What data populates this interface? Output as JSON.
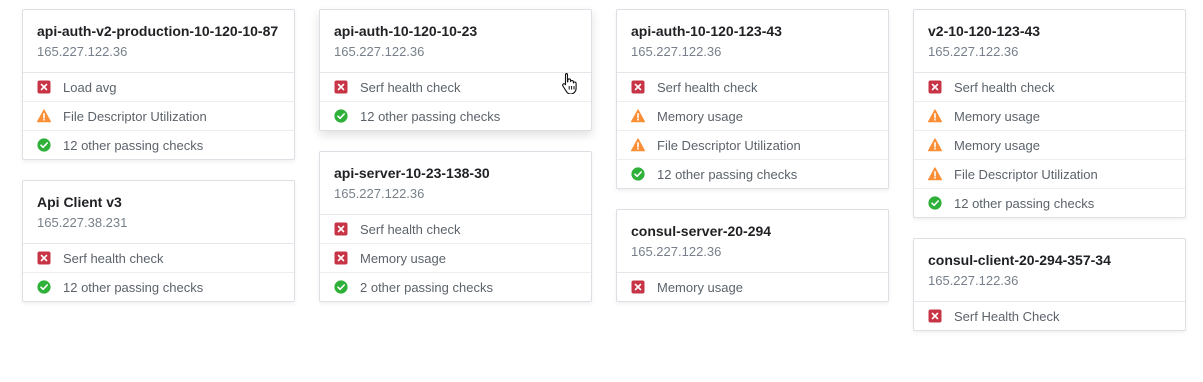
{
  "colors": {
    "critical": "#c73445",
    "warning": "#fa8f37",
    "passing": "#2eb039",
    "border": "#dcdfe3",
    "muted": "#77808a"
  },
  "nodes": [
    [
      {
        "name": "api-auth-v2-production-10-120-10-87",
        "address": "165.227.122.36",
        "checks": [
          {
            "status": "critical",
            "icon": "critical-icon",
            "label": "Load avg"
          },
          {
            "status": "warning",
            "icon": "warning-icon",
            "label": "File Descriptor Utilization"
          },
          {
            "status": "passing",
            "icon": "passing-icon",
            "label": "12 other passing checks"
          }
        ]
      },
      {
        "name": "Api Client v3",
        "address": "165.227.38.231",
        "checks": [
          {
            "status": "critical",
            "icon": "critical-icon",
            "label": "Serf health check"
          },
          {
            "status": "passing",
            "icon": "passing-icon",
            "label": "12 other passing checks"
          }
        ]
      }
    ],
    [
      {
        "name": "api-auth-10-120-10-23",
        "address": "165.227.122.36",
        "hovered": true,
        "checks": [
          {
            "status": "critical",
            "icon": "critical-icon",
            "label": "Serf health check"
          },
          {
            "status": "passing",
            "icon": "passing-icon",
            "label": "12 other passing checks"
          }
        ]
      },
      {
        "name": "api-server-10-23-138-30",
        "address": "165.227.122.36",
        "checks": [
          {
            "status": "critical",
            "icon": "critical-icon",
            "label": "Serf health check"
          },
          {
            "status": "critical",
            "icon": "critical-icon",
            "label": "Memory usage"
          },
          {
            "status": "passing",
            "icon": "passing-icon",
            "label": "2 other passing checks"
          }
        ]
      }
    ],
    [
      {
        "name": "api-auth-10-120-123-43",
        "address": "165.227.122.36",
        "checks": [
          {
            "status": "critical",
            "icon": "critical-icon",
            "label": "Serf health check"
          },
          {
            "status": "warning",
            "icon": "warning-icon",
            "label": "Memory usage"
          },
          {
            "status": "warning",
            "icon": "warning-icon",
            "label": "File Descriptor Utilization"
          },
          {
            "status": "passing",
            "icon": "passing-icon",
            "label": "12 other passing checks"
          }
        ]
      },
      {
        "name": "consul-server-20-294",
        "address": "165.227.122.36",
        "checks": [
          {
            "status": "critical",
            "icon": "critical-icon",
            "label": "Memory usage"
          }
        ]
      }
    ],
    [
      {
        "name": "v2-10-120-123-43",
        "address": "165.227.122.36",
        "checks": [
          {
            "status": "critical",
            "icon": "critical-icon",
            "label": "Serf health check"
          },
          {
            "status": "warning",
            "icon": "warning-icon",
            "label": "Memory usage"
          },
          {
            "status": "warning",
            "icon": "warning-icon",
            "label": "Memory usage"
          },
          {
            "status": "warning",
            "icon": "warning-icon",
            "label": "File Descriptor Utilization"
          },
          {
            "status": "passing",
            "icon": "passing-icon",
            "label": "12 other passing checks"
          }
        ]
      },
      {
        "name": "consul-client-20-294-357-34",
        "address": "165.227.122.36",
        "checks": [
          {
            "status": "critical",
            "icon": "critical-icon",
            "label": "Serf Health Check"
          }
        ]
      }
    ]
  ],
  "cursor": {
    "icon": "hand-pointer-icon"
  }
}
